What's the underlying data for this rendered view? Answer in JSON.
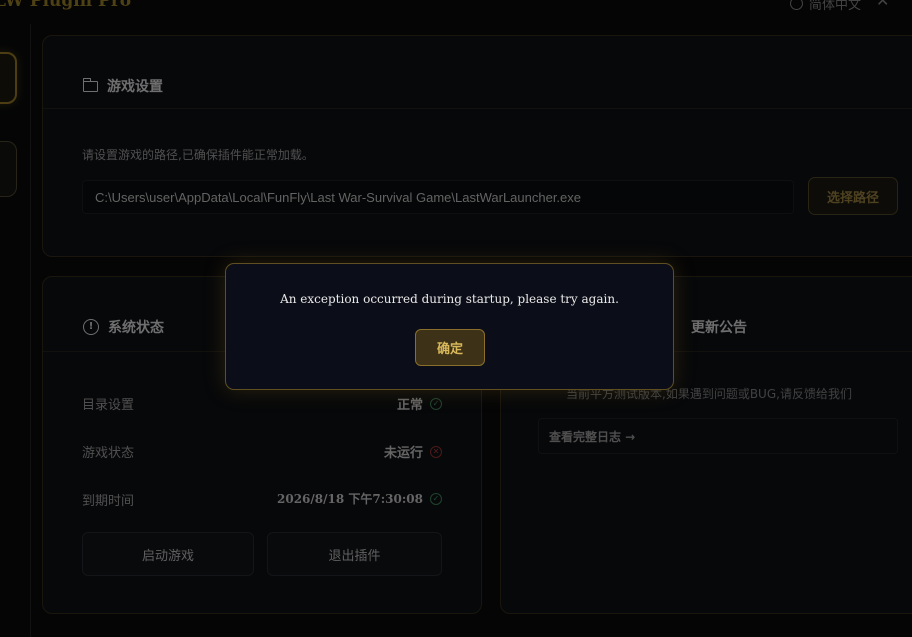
{
  "app": {
    "title": "LW Plugin Pro",
    "language": "简体中文"
  },
  "game_settings": {
    "title": "游戏设置",
    "hint": "请设置游戏的路径,已确保插件能正常加载。",
    "path_value": "C:\\Users\\user\\AppData\\Local\\FunFly\\Last War-Survival Game\\LastWarLauncher.exe",
    "choose_path_label": "选择路径"
  },
  "system_status": {
    "title": "系统状态",
    "rows": [
      {
        "label": "目录设置",
        "value": "正常"
      },
      {
        "label": "游戏状态",
        "value": "未运行"
      },
      {
        "label": "到期时间",
        "value": "2026/8/18 下午7:30:08"
      }
    ],
    "start_game_label": "启动游戏",
    "exit_plugin_label": "退出插件"
  },
  "update_notice": {
    "title": "更新公告",
    "text": "当前平方测试版本,如果遇到问题或BUG,请反馈给我们",
    "full_log_link": "查看完整日志 →"
  },
  "dialog": {
    "message": "An exception occurred during startup, please try again.",
    "ok_label": "确定"
  },
  "colors": {
    "accent_gold": "#8a6f2c",
    "ok_green": "#2d6a47",
    "error_red": "#7a2a2a"
  }
}
